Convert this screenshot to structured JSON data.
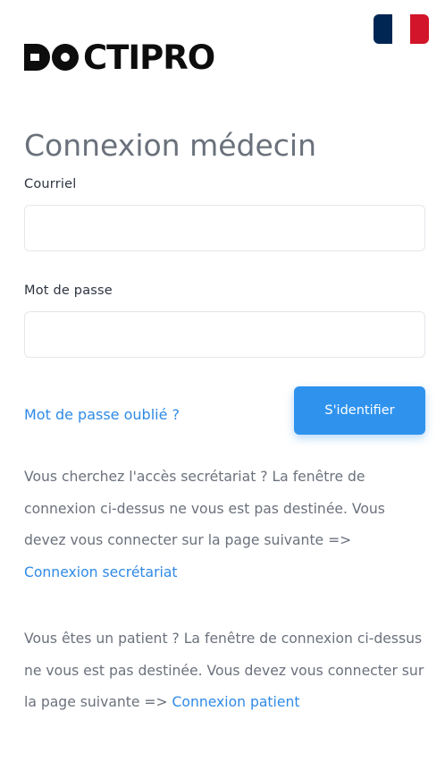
{
  "header": {
    "language_flag": "france-flag",
    "brand": "DOCTIPRO",
    "brand_rest": "CTIPRO"
  },
  "login": {
    "title": "Connexion médecin",
    "email_label": "Courriel",
    "email_value": "",
    "password_label": "Mot de passe",
    "password_value": "",
    "forgot_link": "Mot de passe oublié ?",
    "submit_label": "S'identifier"
  },
  "notice_secretariat": {
    "text": "Vous cherchez l'accès secrétariat ? La fenêtre de connexion ci-dessus ne vous est pas destinée. Vous devez vous connecter sur la page suivante => ",
    "link": "Connexion secrétariat"
  },
  "notice_patient": {
    "text": "Vous êtes un patient ? La fenêtre de connexion ci-dessus ne vous est pas destinée. Vous devez vous connecter sur la page suivante => ",
    "link": "Connexion patient"
  },
  "colors": {
    "accent": "#2f93ee",
    "link": "#2f8ae6",
    "title": "#6a717b",
    "body_text": "#6b717c",
    "flag_blue": "#002654",
    "flag_red": "#d2152a"
  }
}
